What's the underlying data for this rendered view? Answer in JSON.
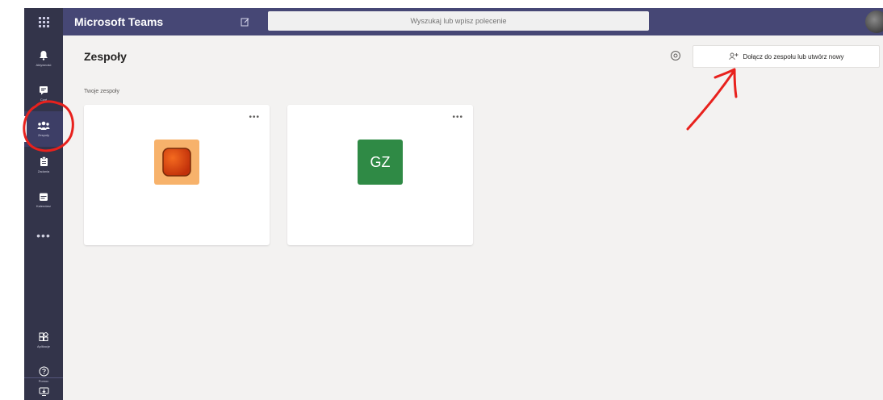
{
  "app": {
    "title": "Microsoft Teams",
    "search_placeholder": "Wyszukaj lub wpisz polecenie"
  },
  "rail": {
    "items": [
      {
        "label": "Aktywność",
        "icon": "bell-icon"
      },
      {
        "label": "Czat",
        "icon": "chat-icon"
      },
      {
        "label": "Zespoły",
        "icon": "teams-icon"
      },
      {
        "label": "Zadania",
        "icon": "assignments-icon"
      },
      {
        "label": "Kalendarz",
        "icon": "calendar-icon"
      },
      {
        "label": "Aplikacje",
        "icon": "apps-icon"
      },
      {
        "label": "Pomoc",
        "icon": "help-icon"
      }
    ],
    "more": "•••",
    "active_index": 2
  },
  "page": {
    "title": "Zespoły",
    "join_button": "Dołącz do zespołu lub utwórz nowy",
    "section_label": "Twoje zespoły"
  },
  "teams": [
    {
      "name": "",
      "logo_type": "image",
      "logo_color": "#f7b26b",
      "more": "•••"
    },
    {
      "name": "",
      "logo_type": "initials",
      "initials": "GZ",
      "logo_color": "#2f8a45",
      "more": "•••"
    }
  ],
  "colors": {
    "titlebar": "#464775",
    "rail": "#33344a",
    "annotation": "#e8211d"
  }
}
